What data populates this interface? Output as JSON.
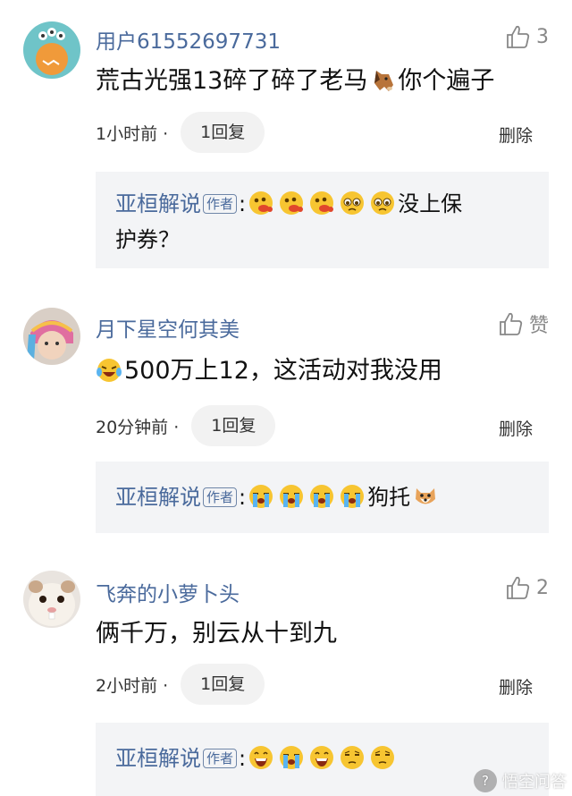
{
  "comments": [
    {
      "username": "用户61552697731",
      "like_count": "3",
      "text_prefix": "荒古光强13碎了碎了老马",
      "text_suffix": "你个遍子",
      "time": "1小时前 ·",
      "reply_count": "1回复",
      "delete_label": "删除",
      "reply": {
        "name": "亚桓解说",
        "tag": "作者",
        "colon": ":",
        "text_end": "没上保",
        "text_wrap": "护券？"
      }
    },
    {
      "username": "月下星空何其美",
      "like_count": "赞",
      "text": "500万上12，这活动对我没用",
      "time": "20分钟前 ·",
      "reply_count": "1回复",
      "delete_label": "删除",
      "reply": {
        "name": "亚桓解说",
        "tag": "作者",
        "colon": ":",
        "text_end": "狗托"
      }
    },
    {
      "username": "飞奔的小萝卜头",
      "like_count": "2",
      "text": "俩千万，别云从十到九",
      "time": "2小时前 ·",
      "reply_count": "1回复",
      "delete_label": "删除",
      "reply": {
        "name": "亚桓解说",
        "tag": "作者",
        "colon": ":"
      }
    }
  ],
  "watermark": {
    "text": "悟空问答"
  },
  "icons": {
    "like": "thumbs-up-icon",
    "emoji_spit": "spitting-face-emoji",
    "emoji_pleading": "pleading-face-emoji",
    "emoji_laugh": "laughing-crying-emoji",
    "emoji_cry": "loud-crying-emoji",
    "emoji_dog": "dog-face-emoji",
    "emoji_horse": "horse-face-emoji",
    "emoji_grin": "grinning-face-emoji",
    "emoji_meh": "meh-face-emoji"
  },
  "colors": {
    "username": "#4a6a9c",
    "reply_bg": "#f3f4f6",
    "pill_bg": "#f2f2f2"
  }
}
